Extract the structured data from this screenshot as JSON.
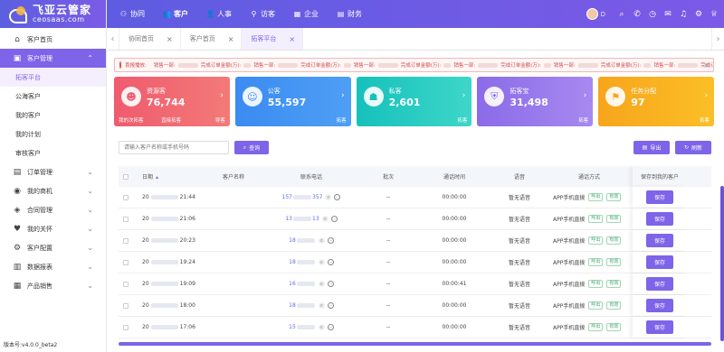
{
  "logo": {
    "cn": "飞亚云管家",
    "en": "ceosaas.com"
  },
  "sidebar": {
    "items": [
      {
        "label": "客户首页",
        "icon": "home-icon"
      },
      {
        "label": "客户管理",
        "icon": "customer-icon",
        "expanded": true,
        "children": [
          "拓客平台",
          "公海客户",
          "我的客户",
          "我的计划",
          "审核客户"
        ]
      },
      {
        "label": "订单管理",
        "icon": "order-icon"
      },
      {
        "label": "我的商机",
        "icon": "location-icon"
      },
      {
        "label": "合同管理",
        "icon": "contract-icon"
      },
      {
        "label": "我的关怀",
        "icon": "care-icon"
      },
      {
        "label": "客户配置",
        "icon": "config-icon"
      },
      {
        "label": "数据报表",
        "icon": "report-icon"
      },
      {
        "label": "产品销售",
        "icon": "product-icon"
      }
    ],
    "version": "版本号:v4.0.0_beta2"
  },
  "topnav": {
    "items": [
      "协同",
      "客户",
      "人事",
      "访客",
      "企业",
      "财务"
    ],
    "active": "客户",
    "user": "D"
  },
  "tabs": [
    "协同首页",
    "客户首页",
    "拓客平台"
  ],
  "active_tab": "拓客平台",
  "notice": {
    "label": "喜报播放:",
    "messages": [
      "销售一部:",
      "完成订单金额(万):",
      "销售一部:",
      "完成订单金额(万):",
      "销售一部:",
      "完成订单金额(万):",
      "销售一部:",
      "完成订单金额(万):",
      "销售一部:",
      "完成订单金额(万):",
      "销售一部:",
      "完成订单金额(万):",
      "销售一部:",
      "完成订单金额(万):"
    ]
  },
  "cards": [
    {
      "title": "资源客",
      "value": "76,744",
      "foot_left": "我的次拓客",
      "foot_mid": "直接拓客",
      "foot_right": "导客",
      "color": "red",
      "icon": "user-icon"
    },
    {
      "title": "公客",
      "value": "55,597",
      "foot_right": "拓客",
      "color": "blue",
      "icon": "group-icon"
    },
    {
      "title": "私客",
      "value": "2,601",
      "foot_right": "拓客",
      "color": "teal",
      "icon": "private-icon"
    },
    {
      "title": "拓客宝",
      "value": "31,498",
      "foot_right": "拓客",
      "color": "purple",
      "icon": "shield-icon"
    },
    {
      "title": "任务分配",
      "value": "97",
      "foot_right": "拓客",
      "color": "orange",
      "icon": "task-icon"
    }
  ],
  "search": {
    "placeholder": "请输入客户名称或手机号码",
    "button": "查询"
  },
  "actions": {
    "export": "导出",
    "refresh": "刷新"
  },
  "table": {
    "headers": [
      "日期",
      "客户名称",
      "联系电话",
      "批次",
      "通话时间",
      "语音",
      "通话方式",
      "保存到我的客户"
    ],
    "rows": [
      {
        "date_pre": "20",
        "date_post": "21:44",
        "phone_pre": "157",
        "phone_post": "357",
        "batch": "--",
        "time": "00:00:00",
        "voice": "暂无语音",
        "method": "APP手机直拨",
        "save": "保存"
      },
      {
        "date_pre": "20",
        "date_post": "21:06",
        "phone_pre": "13",
        "phone_post": "13",
        "batch": "--",
        "time": "00:00:00",
        "voice": "暂无语音",
        "method": "APP手机直拨",
        "save": "保存"
      },
      {
        "date_pre": "20",
        "date_post": "20:23",
        "phone_pre": "18",
        "phone_post": "",
        "batch": "--",
        "time": "00:00:00",
        "voice": "暂无语音",
        "method": "APP手机直拨",
        "save": "保存"
      },
      {
        "date_pre": "20",
        "date_post": "19:24",
        "phone_pre": "18",
        "phone_post": "",
        "batch": "--",
        "time": "00:00:00",
        "voice": "暂无语音",
        "method": "APP手机直拨",
        "save": "保存"
      },
      {
        "date_pre": "20",
        "date_post": "19:09",
        "phone_pre": "16",
        "phone_post": "",
        "batch": "--",
        "time": "00:00:41",
        "voice": "暂无语音",
        "method": "APP手机直拨",
        "save": "保存"
      },
      {
        "date_pre": "20",
        "date_post": "18:00",
        "phone_pre": "18",
        "phone_post": "",
        "batch": "--",
        "time": "00:00:00",
        "voice": "暂无语音",
        "method": "APP手机直拨",
        "save": "保存"
      },
      {
        "date_pre": "20",
        "date_post": "17:06",
        "phone_pre": "15",
        "phone_post": "",
        "batch": "--",
        "time": "00:00:00",
        "voice": "暂无语音",
        "method": "APP手机直拨",
        "save": "保存"
      }
    ],
    "tag_out": "呼出",
    "tag_valid": "有效"
  }
}
